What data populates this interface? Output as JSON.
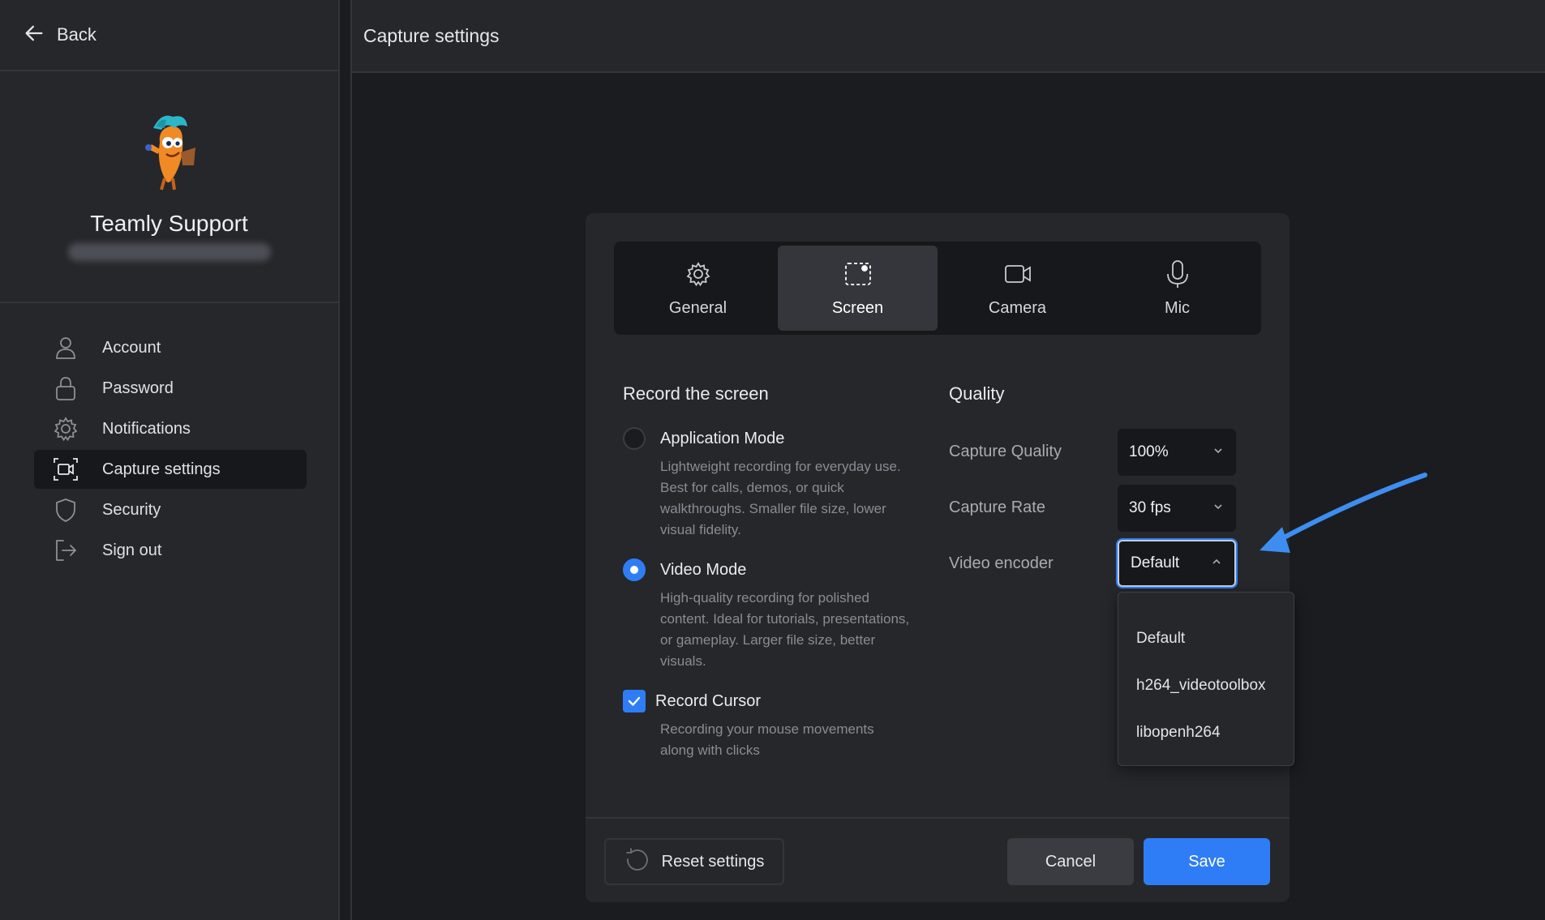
{
  "sidebar": {
    "back_label": "Back",
    "profile": {
      "name": "Teamly Support",
      "email": "",
      "avatar_icon": "carrot-mascot-icon"
    },
    "items": [
      {
        "label": "Account",
        "icon": "user-icon"
      },
      {
        "label": "Password",
        "icon": "lock-icon"
      },
      {
        "label": "Notifications",
        "icon": "gear-icon"
      },
      {
        "label": "Capture settings",
        "icon": "screen-capture-icon",
        "active": true
      },
      {
        "label": "Security",
        "icon": "shield-icon"
      },
      {
        "label": "Sign out",
        "icon": "sign-out-icon"
      }
    ]
  },
  "header": {
    "title": "Capture settings"
  },
  "tabs": [
    {
      "label": "General",
      "icon": "gear-icon"
    },
    {
      "label": "Screen",
      "icon": "screen-select-icon",
      "active": true
    },
    {
      "label": "Camera",
      "icon": "camera-icon"
    },
    {
      "label": "Mic",
      "icon": "microphone-icon"
    }
  ],
  "record": {
    "title": "Record the screen",
    "options": [
      {
        "label": "Application Mode",
        "description": "Lightweight recording for everyday use. Best for calls, demos, or quick walkthroughs. Smaller file size, lower visual fidelity.",
        "checked": false
      },
      {
        "label": "Video Mode",
        "description": "High-quality recording for polished content. Ideal for tutorials, presentations, or gameplay. Larger file size, better visuals.",
        "checked": true
      }
    ],
    "cursor": {
      "label": "Record Cursor",
      "description": "Recording your mouse movements along with clicks",
      "checked": true
    }
  },
  "quality": {
    "title": "Quality",
    "fields": [
      {
        "label": "Capture Quality",
        "value": "100%"
      },
      {
        "label": "Capture Rate",
        "value": "30 fps"
      },
      {
        "label": "Video encoder",
        "value": "Default",
        "open": true
      }
    ],
    "encoder_options": [
      "Default",
      "h264_videotoolbox",
      "libopenh264"
    ]
  },
  "footer": {
    "reset_label": "Reset settings",
    "cancel_label": "Cancel",
    "save_label": "Save"
  },
  "colors": {
    "accent": "#2f7df6",
    "background": "#1b1c1f",
    "panel": "#26272b"
  }
}
